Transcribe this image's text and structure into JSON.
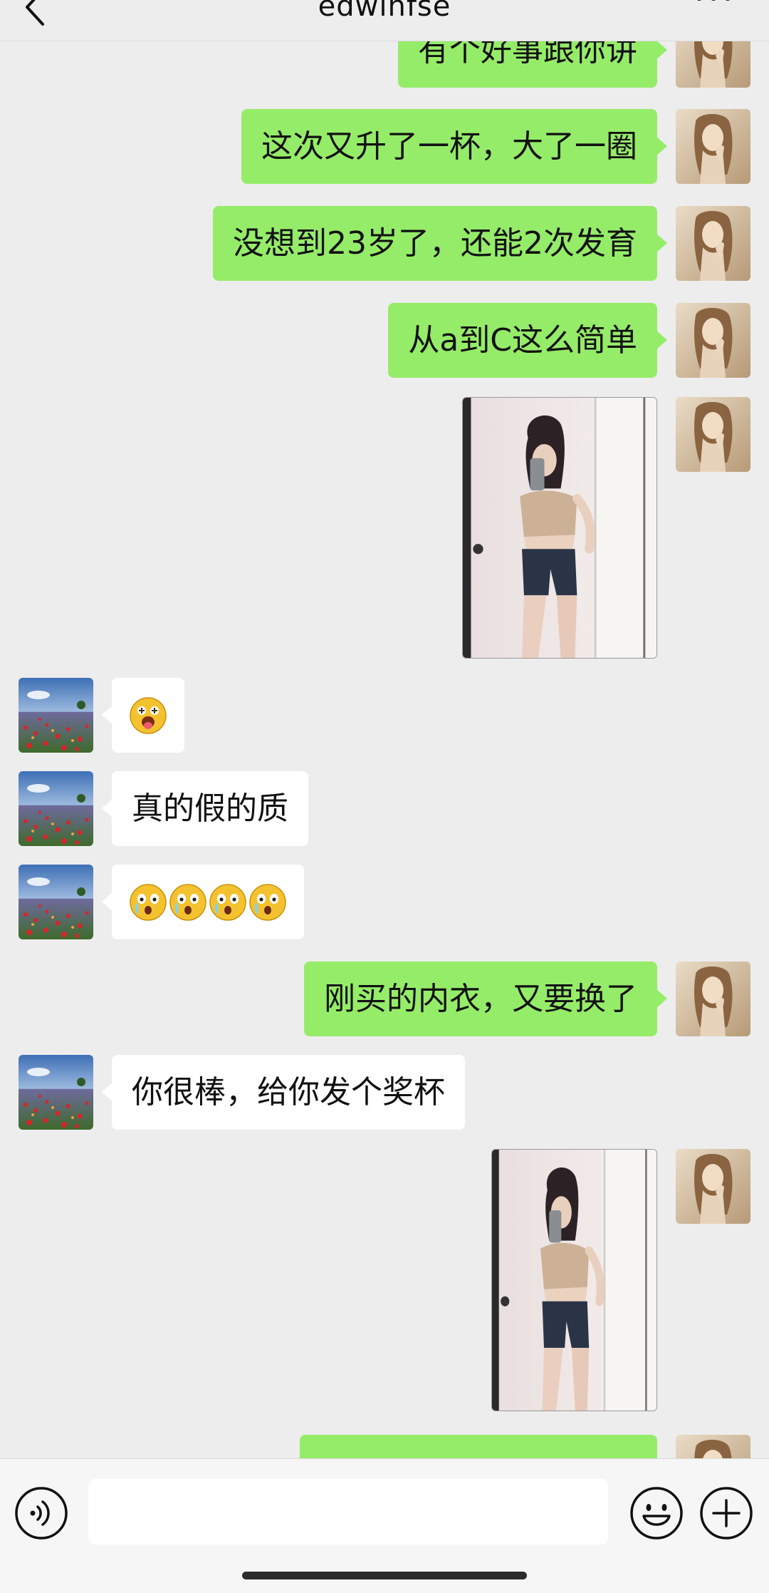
{
  "header": {
    "title": "edwinfse",
    "back_icon": "chevron-left-icon",
    "more_icon": "more-dots-icon"
  },
  "messages": [
    {
      "side": "me",
      "type": "text",
      "text": "有个好事跟你讲"
    },
    {
      "side": "me",
      "type": "text",
      "text": "这次又升了一杯，大了一圈"
    },
    {
      "side": "me",
      "type": "text",
      "text": "没想到23岁了，还能2次发育"
    },
    {
      "side": "me",
      "type": "text",
      "text": "从a到C这么简单"
    },
    {
      "side": "me",
      "type": "image",
      "content": "photo"
    },
    {
      "side": "peer",
      "type": "emoji",
      "emoji": [
        "tongue-out-emoji"
      ]
    },
    {
      "side": "peer",
      "type": "text",
      "text": "真的假的质"
    },
    {
      "side": "peer",
      "type": "emoji",
      "emoji": [
        "shocked-emoji",
        "shocked-emoji",
        "shocked-emoji",
        "shocked-emoji"
      ]
    },
    {
      "side": "me",
      "type": "text",
      "text": "刚买的内衣，又要换了"
    },
    {
      "side": "peer",
      "type": "text",
      "text": "你很棒，给你发个奖杯"
    },
    {
      "side": "me",
      "type": "image",
      "content": "photo"
    },
    {
      "side": "me",
      "type": "text",
      "text": ""
    }
  ],
  "input_bar": {
    "voice_icon": "voice-icon",
    "message_value": "",
    "emoji_icon": "emoji-icon",
    "plus_icon": "plus-icon"
  },
  "colors": {
    "background": "#EDEDED",
    "my_bubble": "#95EC69",
    "peer_bubble": "#FFFFFF",
    "input_bar": "#F6F6F6"
  }
}
